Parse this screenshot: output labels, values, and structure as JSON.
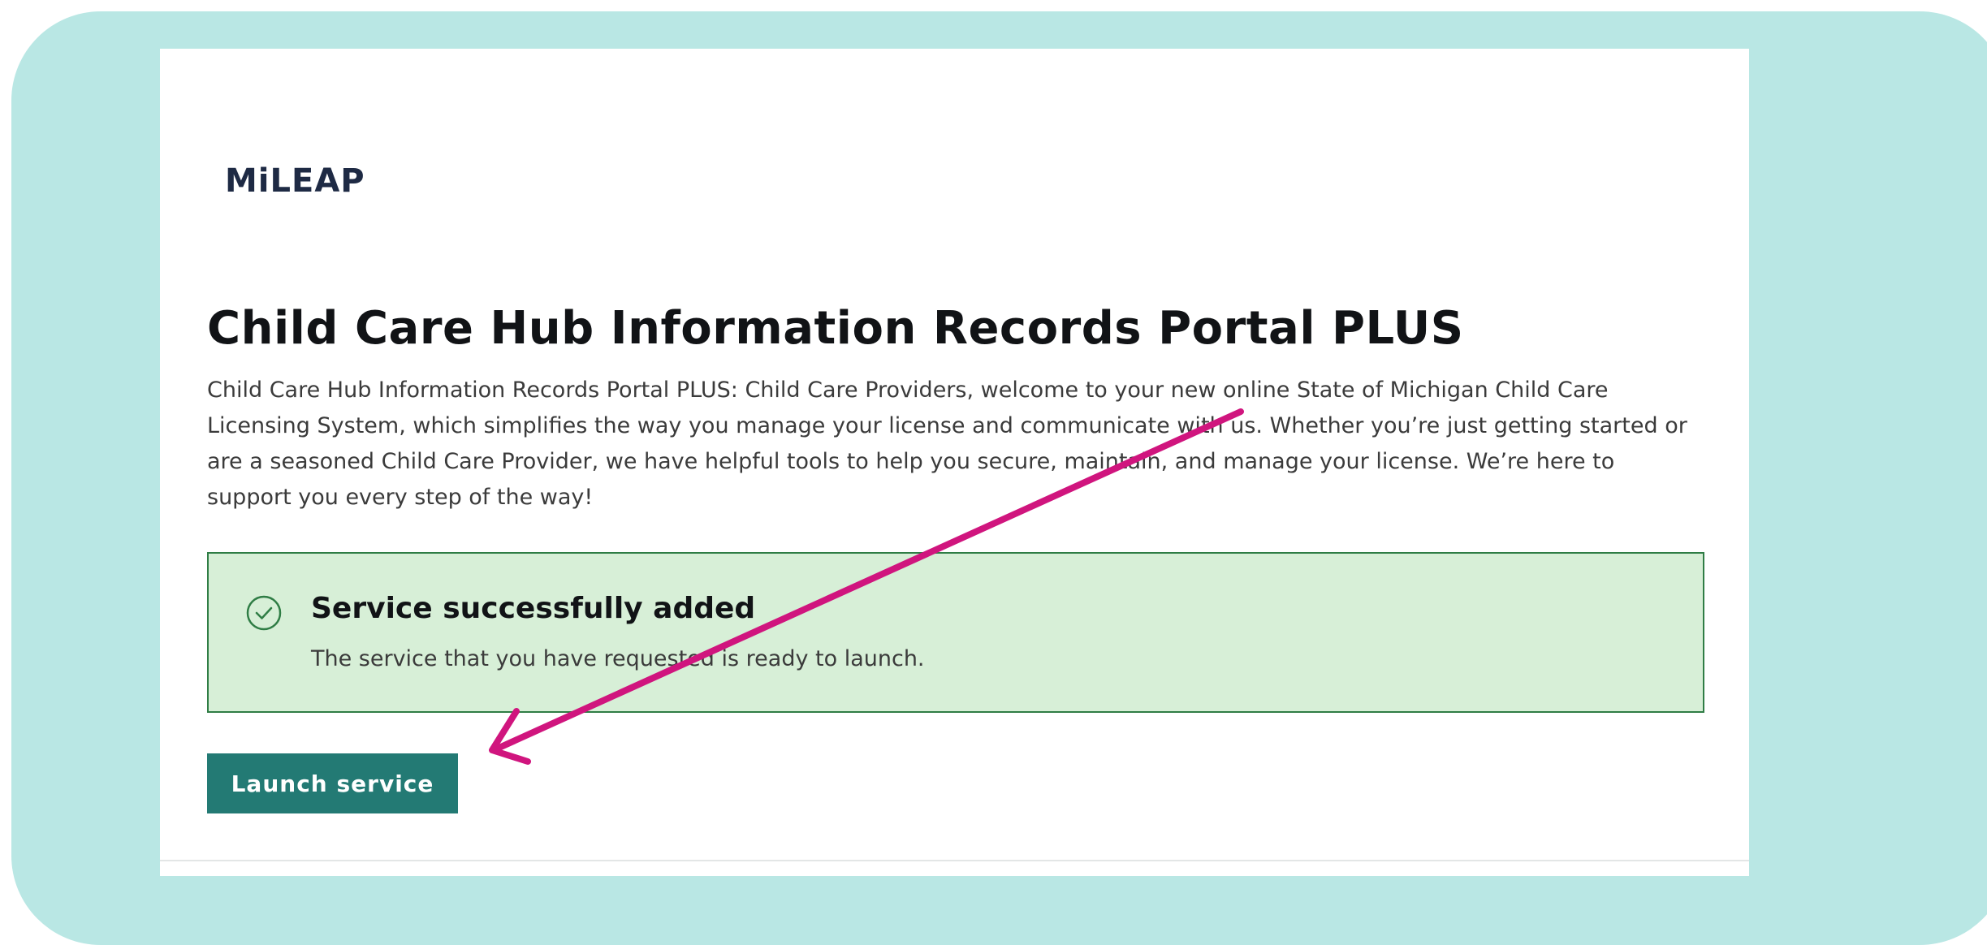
{
  "header": {
    "logo_text": "MiLEAP"
  },
  "main": {
    "title": "Child Care Hub Information Records Portal PLUS",
    "intro": "Child Care Hub Information Records Portal PLUS: Child Care Providers, welcome to your new online State of Michigan Child Care Licensing System, which simplifies the way you manage your license and communicate with us. Whether you’re just getting started or are a seasoned Child Care Provider, we have helpful tools to help you secure, maintain, and manage your license. We’re here to support you every step of the way!"
  },
  "alert": {
    "icon": "check-circle-icon",
    "title": "Service successfully added",
    "message": "The service that you have requested is ready to launch."
  },
  "actions": {
    "launch_label": "Launch service"
  },
  "colors": {
    "frame_background": "#b9e7e4",
    "alert_background": "#d7efd7",
    "alert_border": "#2f7d45",
    "button_background": "#237a74",
    "annotation_arrow": "#d0157e"
  }
}
